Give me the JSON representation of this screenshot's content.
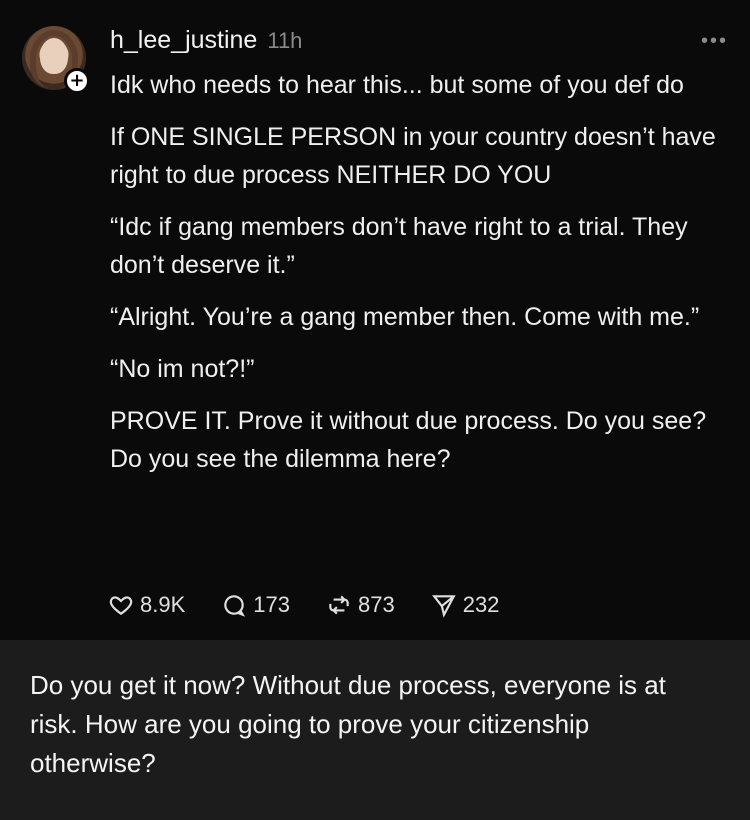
{
  "post": {
    "username": "h_lee_justine",
    "time": "11h",
    "more_label": "•••",
    "paragraphs": [
      "Idk who needs to hear this... but some of you def do",
      "If ONE SINGLE PERSON in your country doesn’t have right to due process NEITHER DO YOU",
      "“Idc if gang members don’t have right to a trial. They don’t deserve it.”",
      "“Alright. You’re a gang member then. Come with me.”",
      "“No im not?!”",
      "PROVE IT. Prove it without due process. Do you see? Do you see the dilemma here?"
    ],
    "actions": {
      "likes": "8.9K",
      "replies": "173",
      "reposts": "873",
      "shares": "232"
    }
  },
  "caption": {
    "text": "Do you get it now? Without due process, everyone is at risk. How are you going to prove your citizenship otherwise?"
  },
  "icons": {
    "like": "heart-icon",
    "reply": "comment-bubble-icon",
    "repost": "repost-icon",
    "share": "send-icon"
  }
}
